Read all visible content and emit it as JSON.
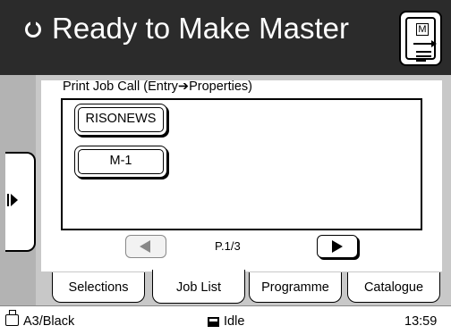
{
  "header": {
    "title": "Ready to Make Master",
    "master_box_label": "M"
  },
  "panel": {
    "title": "Print Job Call (Entry➔Properties)",
    "jobs": [
      {
        "label": "RISONEWS"
      },
      {
        "label": "M-1"
      }
    ],
    "pagination": {
      "page_text": "P.1/3"
    }
  },
  "tabs": [
    {
      "label": "Selections",
      "active": false
    },
    {
      "label": "Job List",
      "active": true
    },
    {
      "label": "Programme",
      "active": false
    },
    {
      "label": "Catalogue",
      "active": false
    }
  ],
  "statusbar": {
    "paper": "A3/Black",
    "state": "Idle",
    "time": "13:59"
  },
  "icons": {
    "header_status": "rotate-icon",
    "master_button": "make-master-icon",
    "side_tab": "expand-arrow-icon",
    "prev": "triangle-left-icon",
    "next": "triangle-right-icon",
    "printer": "printer-icon",
    "idle": "idle-icon"
  }
}
